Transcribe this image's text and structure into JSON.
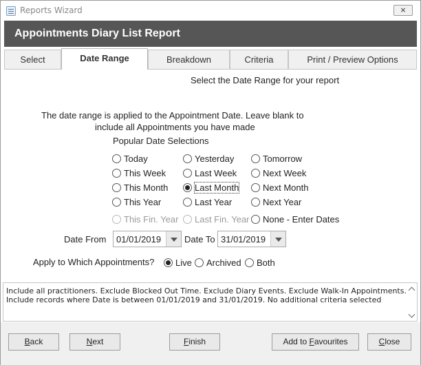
{
  "window": {
    "title": "Reports Wizard",
    "close_glyph": "⨯"
  },
  "header": {
    "title": "Appointments Diary List Report"
  },
  "tabs": [
    {
      "label": "Select"
    },
    {
      "label": "Date Range"
    },
    {
      "label": "Breakdown"
    },
    {
      "label": "Criteria"
    },
    {
      "label": "Print / Preview Options"
    }
  ],
  "date_range": {
    "heading": "Select the Date Range for your report",
    "info_line1": "The date range is applied to the Appointment Date.  Leave blank to",
    "info_line2": "include all Appointments you have made",
    "popular_label": "Popular Date Selections",
    "options": {
      "today": "Today",
      "yesterday": "Yesterday",
      "tomorrow": "Tomorrow",
      "this_week": "This Week",
      "last_week": "Last Week",
      "next_week": "Next Week",
      "this_month": "This Month",
      "last_month": "Last Month",
      "next_month": "Next Month",
      "this_year": "This Year",
      "last_year": "Last Year",
      "next_year": "Next Year",
      "this_fin_year": "This Fin. Year",
      "last_fin_year": "Last Fin. Year",
      "none": "None - Enter Dates"
    },
    "selected_option": "last_month",
    "date_from_label": "Date From",
    "date_from_value": "01/01/2019",
    "date_to_label": "Date To",
    "date_to_value": "31/01/2019",
    "apply_label": "Apply to Which Appointments?",
    "apply_options": {
      "live": "Live",
      "archived": "Archived",
      "both": "Both"
    },
    "apply_selected": "live"
  },
  "summary": {
    "line1": "Include all practitioners. Exclude Blocked Out Time. Exclude Diary Events. Exclude Walk-In Appointments.",
    "line2": "Include records where Date is between 01/01/2019 and 31/01/2019. No additional criteria selected"
  },
  "buttons": {
    "back_first": "B",
    "back_rest": "ack",
    "next_first": "N",
    "next_rest": "ext",
    "finish_first": "F",
    "finish_rest": "inish",
    "fav_pre": "Add to ",
    "fav_first": "F",
    "fav_rest": "avourites",
    "close_first": "C",
    "close_rest": "lose"
  }
}
